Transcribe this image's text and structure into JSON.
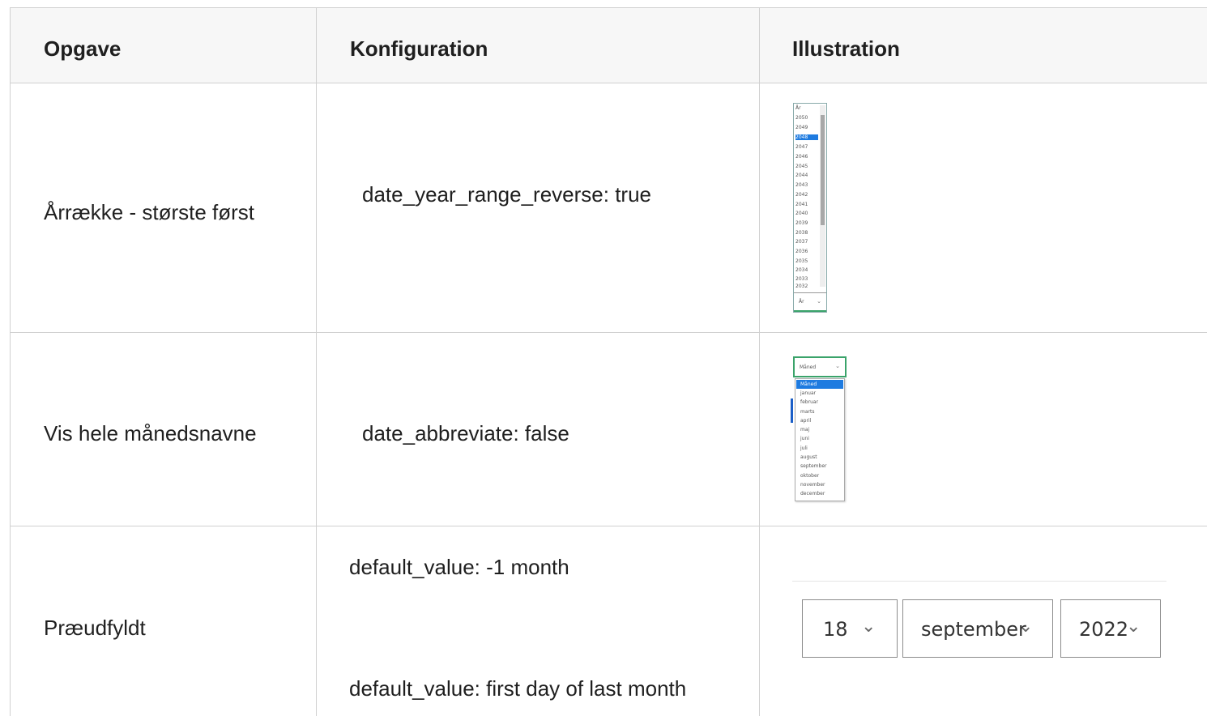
{
  "headers": {
    "task": "Opgave",
    "config": "Konfiguration",
    "illustration": "Illustration"
  },
  "rows": [
    {
      "task": "Årrække - største først",
      "config": [
        "date_year_range_reverse: true"
      ]
    },
    {
      "task": "Vis hele månedsnavne",
      "config": [
        "date_abbreviate: false"
      ]
    },
    {
      "task": "Præudfyldt",
      "config": [
        "default_value: -1 month",
        "default_value: first day of last month"
      ]
    }
  ],
  "year_picker": {
    "placeholder": "År",
    "selected": "2048",
    "years": [
      "År",
      "2050",
      "2049",
      "2048",
      "2047",
      "2046",
      "2045",
      "2044",
      "2043",
      "2042",
      "2041",
      "2040",
      "2039",
      "2038",
      "2037",
      "2036",
      "2035",
      "2034",
      "2033",
      "2032"
    ],
    "select_label": "År"
  },
  "month_picker": {
    "select_label": "Måned",
    "selected": "Måned",
    "months": [
      "Måned",
      "januar",
      "februar",
      "marts",
      "april",
      "maj",
      "juni",
      "juli",
      "august",
      "september",
      "oktober",
      "november",
      "december"
    ]
  },
  "date_fields": {
    "day": "18",
    "month": "september",
    "year": "2022"
  },
  "colors": {
    "selection": "#1e7be0",
    "focus_border": "#3aa36a",
    "header_bg": "#f7f7f7"
  }
}
